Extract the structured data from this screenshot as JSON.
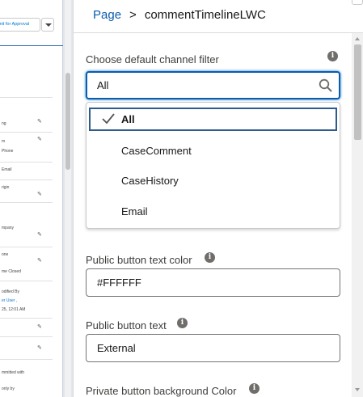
{
  "canvas": {
    "header_button_label": "mit for Approval",
    "fields": [
      {
        "text": "ng"
      },
      {
        "text": "m"
      },
      {
        "text": "Phone"
      },
      {
        "text": "Email"
      },
      {
        "text": "rigin"
      },
      {
        "text": "mpany"
      },
      {
        "text": "one"
      },
      {
        "text": "me Closed"
      },
      {
        "text": "odified By"
      },
      {
        "text": "er User ,",
        "link": true
      },
      {
        "text": "25, 12:01 AM"
      },
      {
        "text": "mmitted with"
      },
      {
        "text": "only by"
      }
    ]
  },
  "breadcrumb": {
    "parent": "Page",
    "separator": ">",
    "current": "commentTimelineLWC"
  },
  "channel_filter": {
    "label": "Choose default channel filter",
    "value": "All",
    "options": [
      {
        "label": "All",
        "selected": true
      },
      {
        "label": "CaseComment",
        "selected": false
      },
      {
        "label": "CaseHistory",
        "selected": false
      },
      {
        "label": "Email",
        "selected": false
      }
    ]
  },
  "public_text_color": {
    "label": "Public button text color",
    "value": "#FFFFFF"
  },
  "public_text": {
    "label": "Public button text",
    "value": "External"
  },
  "private_bg_color": {
    "label": "Private button background Color"
  },
  "icons": {
    "info": "info-icon",
    "search": "search-icon",
    "check": "check-icon",
    "pencil": "pencil-icon"
  },
  "colors": {
    "accent": "#0b5cab",
    "link": "#0176d3",
    "selected_border": "#2f5a8c",
    "info_icon": "#706e6b"
  }
}
